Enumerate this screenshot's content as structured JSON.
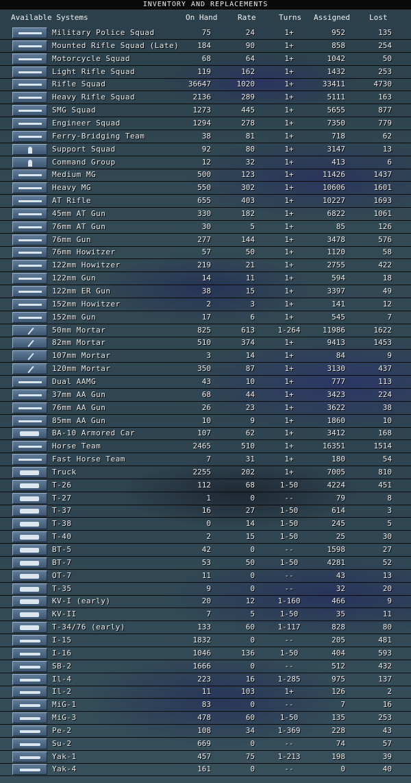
{
  "title": "INVENTORY AND REPLACEMENTS",
  "columns": {
    "name": "Available Systems",
    "on_hand": "On Hand",
    "rate": "Rate",
    "turns": "Turns",
    "assigned": "Assigned",
    "lost": "Lost"
  },
  "rows": [
    {
      "name": "Military Police Squad",
      "on_hand": "75",
      "rate": "24",
      "turns": "1+",
      "assigned": "952",
      "lost": "135",
      "icon": "rifle-icon"
    },
    {
      "name": "Mounted Rifle Squad (Late)",
      "on_hand": "184",
      "rate": "90",
      "turns": "1+",
      "assigned": "858",
      "lost": "254",
      "icon": "horse-rider-icon"
    },
    {
      "name": "Motorcycle Squad",
      "on_hand": "68",
      "rate": "64",
      "turns": "1+",
      "assigned": "1042",
      "lost": "50",
      "icon": "motorcycle-icon"
    },
    {
      "name": "Light Rifle Squad",
      "on_hand": "119",
      "rate": "162",
      "turns": "1+",
      "assigned": "1432",
      "lost": "253",
      "icon": "rifle-icon"
    },
    {
      "name": "Rifle Squad",
      "on_hand": "36647",
      "rate": "1020",
      "turns": "1+",
      "assigned": "33411",
      "lost": "4730",
      "icon": "rifle-icon"
    },
    {
      "name": "Heavy Rifle Squad",
      "on_hand": "2136",
      "rate": "289",
      "turns": "1+",
      "assigned": "5111",
      "lost": "163",
      "icon": "rifle-icon"
    },
    {
      "name": "SMG Squad",
      "on_hand": "1273",
      "rate": "445",
      "turns": "1+",
      "assigned": "5655",
      "lost": "877",
      "icon": "smg-icon"
    },
    {
      "name": "Engineer Squad",
      "on_hand": "1294",
      "rate": "278",
      "turns": "1+",
      "assigned": "7350",
      "lost": "779",
      "icon": "engineer-icon"
    },
    {
      "name": "Ferry-Bridging Team",
      "on_hand": "38",
      "rate": "81",
      "turns": "1+",
      "assigned": "718",
      "lost": "62",
      "icon": "engineer-icon"
    },
    {
      "name": "Support Squad",
      "on_hand": "92",
      "rate": "80",
      "turns": "1+",
      "assigned": "3147",
      "lost": "13",
      "icon": "soldier-icon"
    },
    {
      "name": "Command Group",
      "on_hand": "12",
      "rate": "32",
      "turns": "1+",
      "assigned": "413",
      "lost": "6",
      "icon": "soldier-icon"
    },
    {
      "name": "Medium MG",
      "on_hand": "500",
      "rate": "123",
      "turns": "1+",
      "assigned": "11426",
      "lost": "1437",
      "icon": "machine-gun-icon"
    },
    {
      "name": "Heavy MG",
      "on_hand": "550",
      "rate": "302",
      "turns": "1+",
      "assigned": "10606",
      "lost": "1601",
      "icon": "machine-gun-icon"
    },
    {
      "name": "AT Rifle",
      "on_hand": "655",
      "rate": "403",
      "turns": "1+",
      "assigned": "10227",
      "lost": "1693",
      "icon": "rifle-icon"
    },
    {
      "name": "45mm AT Gun",
      "on_hand": "330",
      "rate": "182",
      "turns": "1+",
      "assigned": "6822",
      "lost": "1061",
      "icon": "field-gun-icon"
    },
    {
      "name": "76mm AT Gun",
      "on_hand": "30",
      "rate": "5",
      "turns": "1+",
      "assigned": "85",
      "lost": "126",
      "icon": "field-gun-icon"
    },
    {
      "name": "76mm Gun",
      "on_hand": "277",
      "rate": "144",
      "turns": "1+",
      "assigned": "3478",
      "lost": "576",
      "icon": "field-gun-icon"
    },
    {
      "name": "76mm Howitzer",
      "on_hand": "57",
      "rate": "50",
      "turns": "1+",
      "assigned": "1120",
      "lost": "58",
      "icon": "field-gun-icon"
    },
    {
      "name": "122mm Howitzer",
      "on_hand": "219",
      "rate": "21",
      "turns": "1+",
      "assigned": "2755",
      "lost": "422",
      "icon": "field-gun-icon"
    },
    {
      "name": "122mm Gun",
      "on_hand": "14",
      "rate": "11",
      "turns": "1+",
      "assigned": "594",
      "lost": "18",
      "icon": "field-gun-icon"
    },
    {
      "name": "122mm ER Gun",
      "on_hand": "38",
      "rate": "15",
      "turns": "1+",
      "assigned": "3397",
      "lost": "49",
      "icon": "field-gun-icon"
    },
    {
      "name": "152mm Howitzer",
      "on_hand": "2",
      "rate": "3",
      "turns": "1+",
      "assigned": "141",
      "lost": "12",
      "icon": "field-gun-icon"
    },
    {
      "name": "152mm Gun",
      "on_hand": "17",
      "rate": "6",
      "turns": "1+",
      "assigned": "545",
      "lost": "7",
      "icon": "field-gun-icon"
    },
    {
      "name": "50mm Mortar",
      "on_hand": "825",
      "rate": "613",
      "turns": "1-264",
      "assigned": "11986",
      "lost": "1622",
      "icon": "mortar-icon"
    },
    {
      "name": "82mm Mortar",
      "on_hand": "510",
      "rate": "374",
      "turns": "1+",
      "assigned": "9413",
      "lost": "1453",
      "icon": "mortar-icon"
    },
    {
      "name": "107mm Mortar",
      "on_hand": "3",
      "rate": "14",
      "turns": "1+",
      "assigned": "84",
      "lost": "9",
      "icon": "mortar-icon"
    },
    {
      "name": "120mm Mortar",
      "on_hand": "350",
      "rate": "87",
      "turns": "1+",
      "assigned": "3130",
      "lost": "437",
      "icon": "mortar-icon"
    },
    {
      "name": "Dual AAMG",
      "on_hand": "43",
      "rate": "10",
      "turns": "1+",
      "assigned": "777",
      "lost": "113",
      "icon": "aa-gun-icon"
    },
    {
      "name": "37mm AA Gun",
      "on_hand": "68",
      "rate": "44",
      "turns": "1+",
      "assigned": "3423",
      "lost": "224",
      "icon": "aa-gun-icon"
    },
    {
      "name": "76mm AA Gun",
      "on_hand": "26",
      "rate": "23",
      "turns": "1+",
      "assigned": "3622",
      "lost": "38",
      "icon": "aa-gun-icon"
    },
    {
      "name": "85mm AA Gun",
      "on_hand": "10",
      "rate": "9",
      "turns": "1+",
      "assigned": "1860",
      "lost": "10",
      "icon": "aa-gun-icon"
    },
    {
      "name": "BA-10 Armored Car",
      "on_hand": "107",
      "rate": "62",
      "turns": "1+",
      "assigned": "3412",
      "lost": "168",
      "icon": "armored-car-icon"
    },
    {
      "name": "Horse Team",
      "on_hand": "2465",
      "rate": "510",
      "turns": "1+",
      "assigned": "16351",
      "lost": "1514",
      "icon": "horse-icon"
    },
    {
      "name": "Fast Horse Team",
      "on_hand": "7",
      "rate": "31",
      "turns": "1+",
      "assigned": "180",
      "lost": "54",
      "icon": "horse-icon"
    },
    {
      "name": "Truck",
      "on_hand": "2255",
      "rate": "202",
      "turns": "1+",
      "assigned": "7005",
      "lost": "810",
      "icon": "truck-icon"
    },
    {
      "name": "T-26",
      "on_hand": "112",
      "rate": "68",
      "turns": "1-50",
      "assigned": "4224",
      "lost": "451",
      "icon": "tank-icon"
    },
    {
      "name": "T-27",
      "on_hand": "1",
      "rate": "0",
      "turns": "--",
      "assigned": "79",
      "lost": "8",
      "icon": "tank-icon"
    },
    {
      "name": "T-37",
      "on_hand": "16",
      "rate": "27",
      "turns": "1-50",
      "assigned": "614",
      "lost": "3",
      "icon": "tank-icon"
    },
    {
      "name": "T-38",
      "on_hand": "0",
      "rate": "14",
      "turns": "1-50",
      "assigned": "245",
      "lost": "5",
      "icon": "tank-icon"
    },
    {
      "name": "T-40",
      "on_hand": "2",
      "rate": "15",
      "turns": "1-50",
      "assigned": "25",
      "lost": "30",
      "icon": "tank-icon"
    },
    {
      "name": "BT-5",
      "on_hand": "42",
      "rate": "0",
      "turns": "--",
      "assigned": "1598",
      "lost": "27",
      "icon": "tank-icon"
    },
    {
      "name": "BT-7",
      "on_hand": "53",
      "rate": "50",
      "turns": "1-50",
      "assigned": "4281",
      "lost": "52",
      "icon": "tank-icon"
    },
    {
      "name": "OT-7",
      "on_hand": "11",
      "rate": "0",
      "turns": "--",
      "assigned": "43",
      "lost": "13",
      "icon": "tank-icon"
    },
    {
      "name": "T-35",
      "on_hand": "9",
      "rate": "0",
      "turns": "--",
      "assigned": "32",
      "lost": "20",
      "icon": "tank-icon"
    },
    {
      "name": "KV-I (early)",
      "on_hand": "20",
      "rate": "12",
      "turns": "1-160",
      "assigned": "466",
      "lost": "9",
      "icon": "tank-icon"
    },
    {
      "name": "KV-II",
      "on_hand": "7",
      "rate": "5",
      "turns": "1-50",
      "assigned": "35",
      "lost": "11",
      "icon": "tank-icon"
    },
    {
      "name": "T-34/76 (early)",
      "on_hand": "133",
      "rate": "60",
      "turns": "1-117",
      "assigned": "828",
      "lost": "80",
      "icon": "tank-icon"
    },
    {
      "name": "I-15",
      "on_hand": "1832",
      "rate": "0",
      "turns": "--",
      "assigned": "205",
      "lost": "481",
      "icon": "plane-icon"
    },
    {
      "name": "I-16",
      "on_hand": "1046",
      "rate": "136",
      "turns": "1-50",
      "assigned": "404",
      "lost": "593",
      "icon": "plane-icon"
    },
    {
      "name": "SB-2",
      "on_hand": "1666",
      "rate": "0",
      "turns": "--",
      "assigned": "512",
      "lost": "432",
      "icon": "plane-icon"
    },
    {
      "name": "Il-4",
      "on_hand": "223",
      "rate": "16",
      "turns": "1-285",
      "assigned": "975",
      "lost": "137",
      "icon": "plane-icon"
    },
    {
      "name": "Il-2",
      "on_hand": "11",
      "rate": "103",
      "turns": "1+",
      "assigned": "126",
      "lost": "2",
      "icon": "plane-icon"
    },
    {
      "name": "MiG-1",
      "on_hand": "83",
      "rate": "0",
      "turns": "--",
      "assigned": "7",
      "lost": "16",
      "icon": "plane-icon"
    },
    {
      "name": "MiG-3",
      "on_hand": "478",
      "rate": "60",
      "turns": "1-50",
      "assigned": "135",
      "lost": "253",
      "icon": "plane-icon"
    },
    {
      "name": "Pe-2",
      "on_hand": "108",
      "rate": "34",
      "turns": "1-369",
      "assigned": "228",
      "lost": "43",
      "icon": "plane-icon"
    },
    {
      "name": "Su-2",
      "on_hand": "669",
      "rate": "0",
      "turns": "--",
      "assigned": "74",
      "lost": "57",
      "icon": "plane-icon"
    },
    {
      "name": "Yak-1",
      "on_hand": "457",
      "rate": "75",
      "turns": "1-213",
      "assigned": "198",
      "lost": "39",
      "icon": "plane-icon"
    },
    {
      "name": "Yak-4",
      "on_hand": "161",
      "rate": "0",
      "turns": "--",
      "assigned": "0",
      "lost": "40",
      "icon": "plane-icon"
    }
  ]
}
